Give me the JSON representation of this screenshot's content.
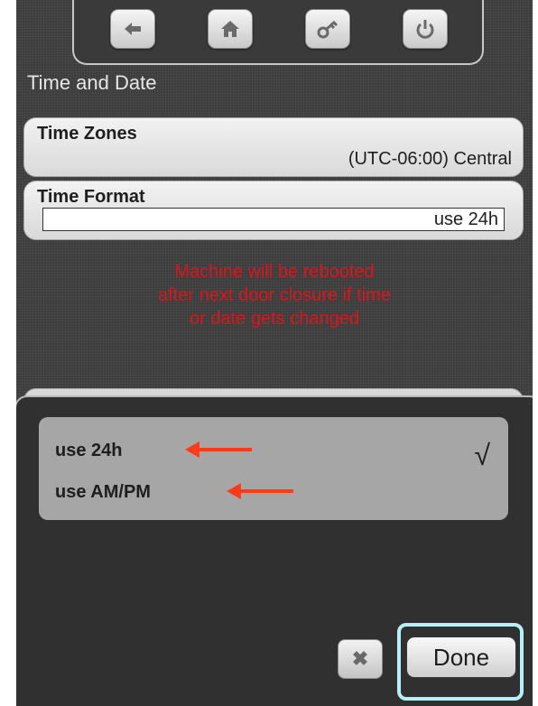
{
  "nav": {
    "icons": [
      "back-arrow-icon",
      "home-icon",
      "key-icon",
      "power-icon"
    ]
  },
  "page": {
    "title": "Time and Date"
  },
  "time_zones": {
    "label": "Time Zones",
    "value": "(UTC-06:00) Central"
  },
  "time_format": {
    "label": "Time Format",
    "value": "use 24h"
  },
  "warning": {
    "lines": [
      "Machine will be rebooted",
      "after next door closure if time",
      "or date gets changed"
    ],
    "color": "#e0121b"
  },
  "picker": {
    "options": [
      {
        "label": "use 24h",
        "selected": true
      },
      {
        "label": "use AM/PM",
        "selected": false
      }
    ],
    "check_mark": "√",
    "cancel_icon": "✖",
    "done_label": "Done"
  },
  "colors": {
    "annotation_arrow": "#ff3b1a",
    "done_highlight": "#b7f0f6",
    "background": "#3c3c3c"
  }
}
